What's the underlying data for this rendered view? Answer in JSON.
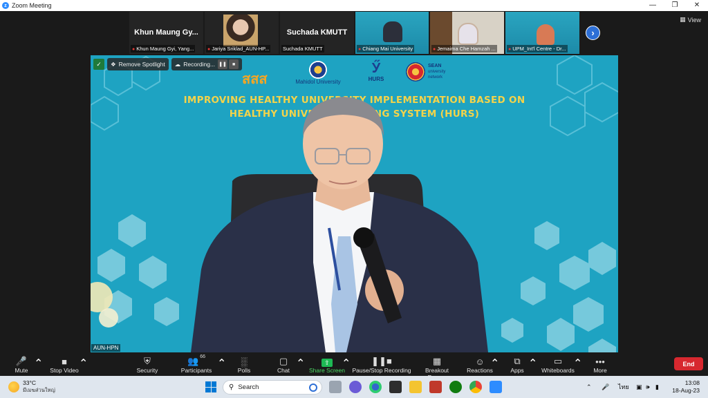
{
  "window": {
    "title": "Zoom Meeting"
  },
  "view_button": {
    "label": "View"
  },
  "thumbnails": [
    {
      "big_name": "Khun Maung Gy...",
      "label": "Khun Maung Gyi, Yang...",
      "muted": true
    },
    {
      "big_name": "",
      "label": "Jariya Sriklad_AUN-HP...",
      "muted": true
    },
    {
      "big_name": "Suchada KMUTT",
      "label": "Suchada KMUTT",
      "muted": false
    },
    {
      "big_name": "",
      "label": "Chiang Mai University",
      "muted": true
    },
    {
      "big_name": "",
      "label": "Jemaima Che Hamzah ...",
      "muted": true
    },
    {
      "big_name": "",
      "label": "UPM_Int'l Centre - Dr...",
      "muted": true
    }
  ],
  "stage": {
    "toolbar": {
      "remove_spotlight": "Remove Spotlight",
      "recording": "Recording..."
    },
    "logos": {
      "thaihealth": "สสส",
      "mahidol": "Mahidol University",
      "hurs": "HURS",
      "sean_1": "SEAN",
      "sean_2": "university",
      "sean_3": "network"
    },
    "title_line1": "IMPROVING HEALTHY UNIVERSITY IMPLEMENTATION BASED ON",
    "title_line2": "HEALTHY UNIVERSITY RATING SYSTEM (HURS)",
    "name_tag": "AUN-HPN"
  },
  "zoom_toolbar": {
    "mute": "Mute",
    "stop_video": "Stop Video",
    "security": "Security",
    "participants": "Participants",
    "participants_count": "66",
    "polls": "Polls",
    "chat": "Chat",
    "share_screen": "Share Screen",
    "pause_stop_recording": "Pause/Stop Recording",
    "breakout_rooms": "Breakout Rooms",
    "reactions": "Reactions",
    "apps": "Apps",
    "whiteboards": "Whiteboards",
    "more": "More",
    "end": "End"
  },
  "taskbar": {
    "weather_temp": "33°C",
    "weather_desc": "มีเมฆส่วนใหญ่",
    "search_placeholder": "Search",
    "language": "ไทย",
    "time": "13:08",
    "date": "18-Aug-23"
  }
}
